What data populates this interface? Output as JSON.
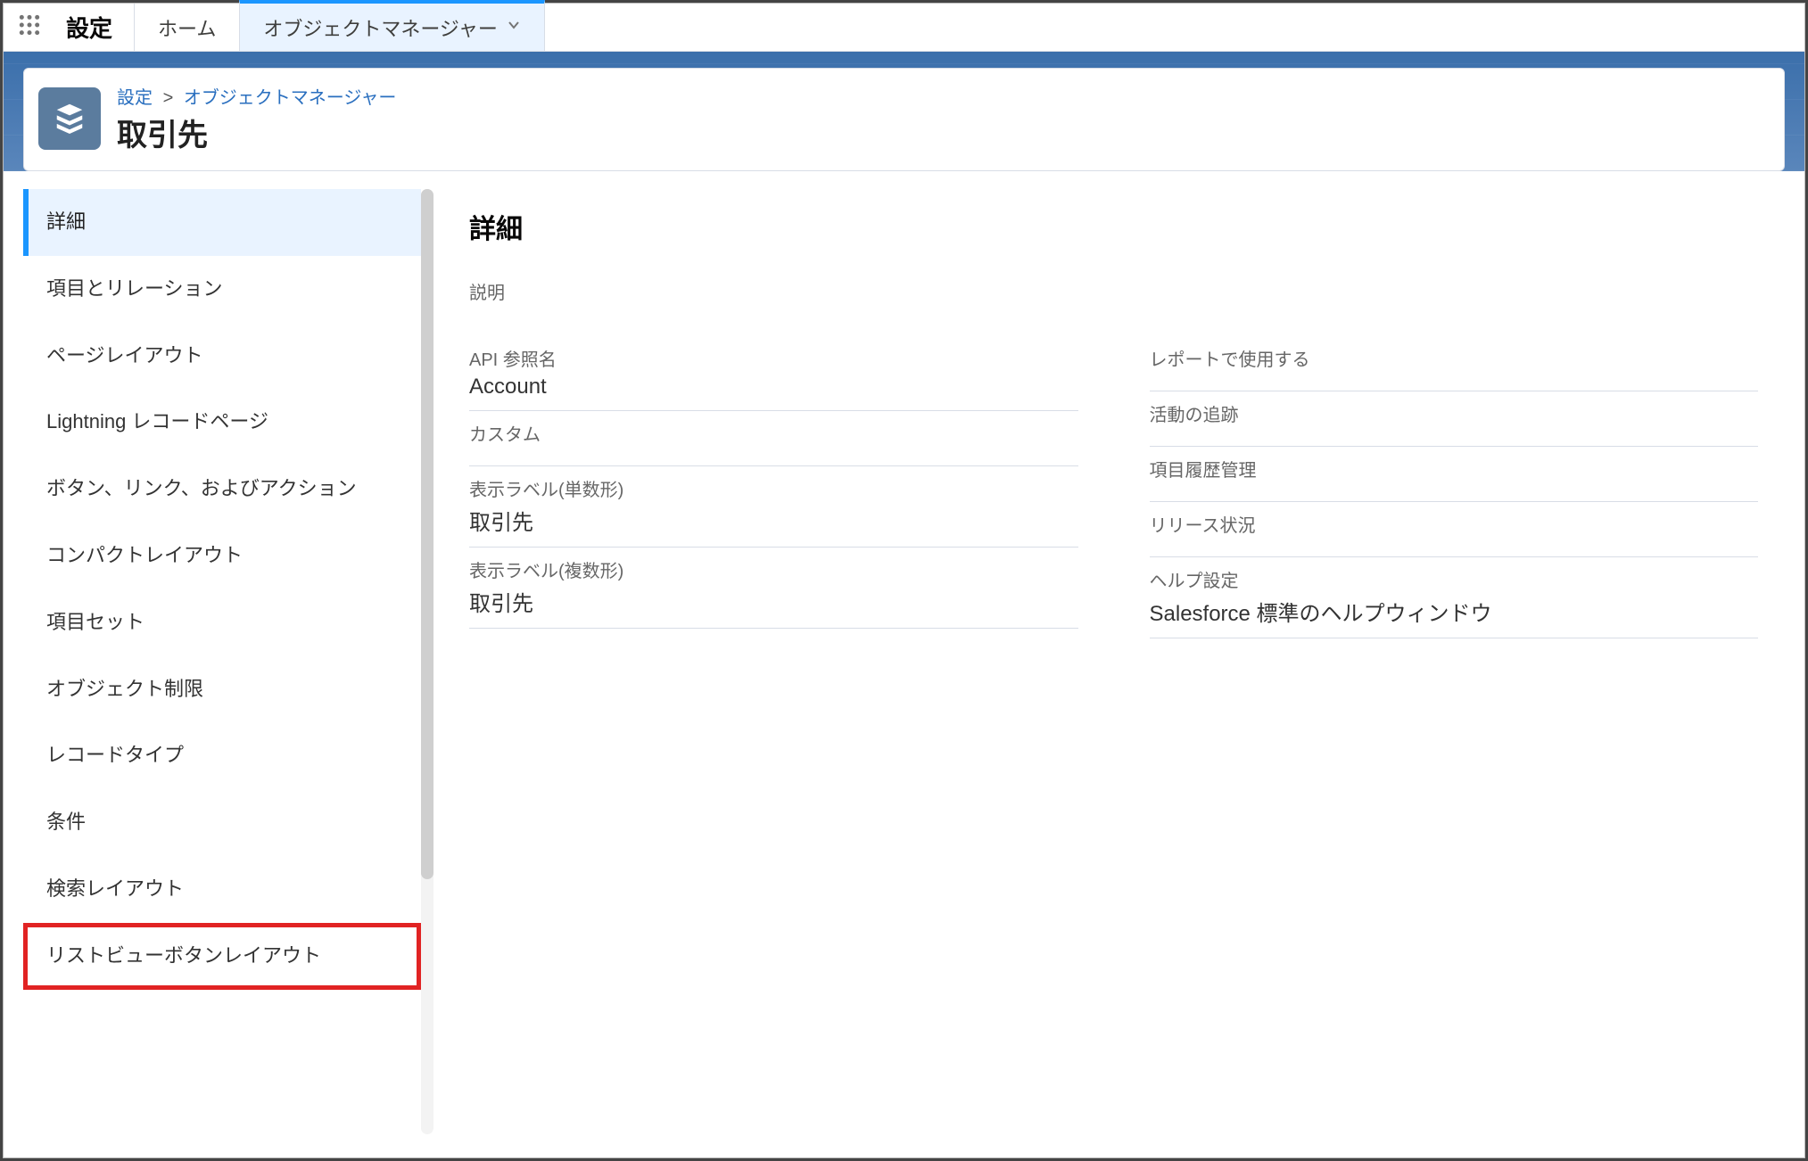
{
  "nav": {
    "app_label": "設定",
    "tabs": [
      {
        "id": "home",
        "label": "ホーム",
        "active": false,
        "hasMenu": false
      },
      {
        "id": "object-manager",
        "label": "オブジェクトマネージャー",
        "active": true,
        "hasMenu": true
      }
    ]
  },
  "breadcrumb": {
    "part1": "設定",
    "sep": ">",
    "part2": "オブジェクトマネージャー"
  },
  "page_title": "取引先",
  "sidebar": {
    "items": [
      {
        "id": "details",
        "label": "詳細",
        "active": true,
        "highlighted": false
      },
      {
        "id": "fields",
        "label": "項目とリレーション",
        "active": false,
        "highlighted": false
      },
      {
        "id": "page-layouts",
        "label": "ページレイアウト",
        "active": false,
        "highlighted": false
      },
      {
        "id": "lightning-pages",
        "label": "Lightning レコードページ",
        "active": false,
        "highlighted": false
      },
      {
        "id": "buttons-links",
        "label": "ボタン、リンク、およびアクション",
        "active": false,
        "highlighted": false
      },
      {
        "id": "compact-layouts",
        "label": "コンパクトレイアウト",
        "active": false,
        "highlighted": false
      },
      {
        "id": "field-sets",
        "label": "項目セット",
        "active": false,
        "highlighted": false
      },
      {
        "id": "object-limits",
        "label": "オブジェクト制限",
        "active": false,
        "highlighted": false
      },
      {
        "id": "record-types",
        "label": "レコードタイプ",
        "active": false,
        "highlighted": false
      },
      {
        "id": "conditions",
        "label": "条件",
        "active": false,
        "highlighted": false
      },
      {
        "id": "search-layouts",
        "label": "検索レイアウト",
        "active": false,
        "highlighted": false
      },
      {
        "id": "listview-buttons",
        "label": "リストビューボタンレイアウト",
        "active": false,
        "highlighted": true
      }
    ]
  },
  "details": {
    "section_title": "詳細",
    "description_label": "説明",
    "left": [
      {
        "label": "API 参照名",
        "value": "Account"
      },
      {
        "label": "カスタム",
        "value": ""
      },
      {
        "label": "表示ラベル(単数形)",
        "value": "取引先"
      },
      {
        "label": "表示ラベル(複数形)",
        "value": "取引先"
      }
    ],
    "right": [
      {
        "label": "レポートで使用する",
        "value": ""
      },
      {
        "label": "活動の追跡",
        "value": ""
      },
      {
        "label": "項目履歴管理",
        "value": ""
      },
      {
        "label": "リリース状況",
        "value": ""
      },
      {
        "label": "ヘルプ設定",
        "value": "Salesforce 標準のヘルプウィンドウ"
      }
    ]
  }
}
